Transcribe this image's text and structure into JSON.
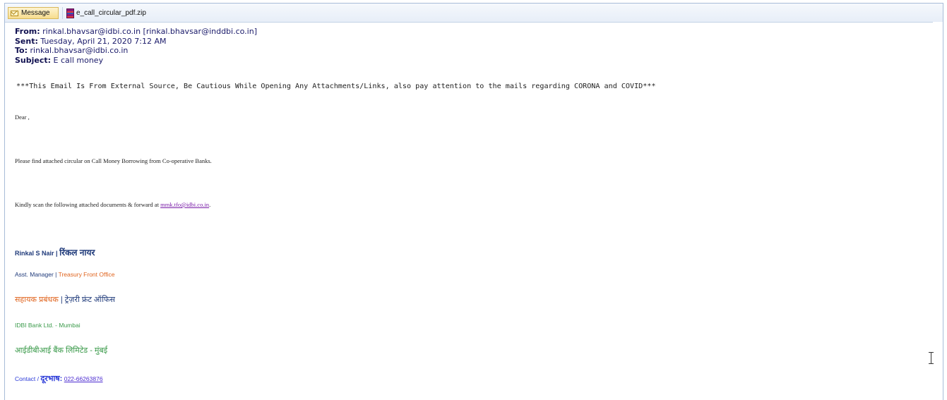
{
  "tabs": {
    "message_label": "Message",
    "attachment_label": "e_call_circular_pdf.zip",
    "message_icon": "envelope-icon",
    "attachment_icon": "zip-archive-icon"
  },
  "header": {
    "from_label": "From:",
    "from_value": "rinkal.bhavsar@idbi.co.in [rinkal.bhavsar@inddbi.co.in]",
    "sent_label": "Sent:",
    "sent_value": "Tuesday, April 21, 2020 7:12 AM",
    "to_label": "To:",
    "to_value": "rinkal.bhavsar@idbi.co.in",
    "subject_label": "Subject:",
    "subject_value": "E call money"
  },
  "body": {
    "warning": "***This Email Is From External Source, Be Cautious While Opening Any Attachments/Links, also pay attention to the mails regarding CORONA and COVID***",
    "greeting": "Dear ,",
    "line1": "Please find attached circular on Call Money Borrowing from Co-operative Banks.",
    "line2_prefix": "Kindly scan the following  attached documents & forward at ",
    "line2_email": "mmk.tfo@idbi.co.in",
    "line2_suffix": "."
  },
  "signature": {
    "name_en": "Rinkal S Nair",
    "separator": " | ",
    "name_hi": "रिंकल  नायर",
    "title_en_part1": "Asst. Manager",
    "title_en_part2": "Treasury Front Office",
    "title_hi_part1": "सहायक  प्रबंधक ",
    "title_hi_part2": " ट्रेज़री  फ्रंट  ऑफिस",
    "bank_en": "IDBI Bank Ltd. - Mumbai",
    "bank_hi": "आईडीबीआई  बैंक  लिमिटेड  -  मुंबई",
    "contact_label": "Contact / ",
    "contact_label_hi": "दूरभाष:",
    "contact_number": "022-66263876"
  },
  "colors": {
    "navy": "#1f3a7a",
    "orange": "#e0641e",
    "green": "#3a9a4a",
    "blue": "#2a3ad8"
  }
}
